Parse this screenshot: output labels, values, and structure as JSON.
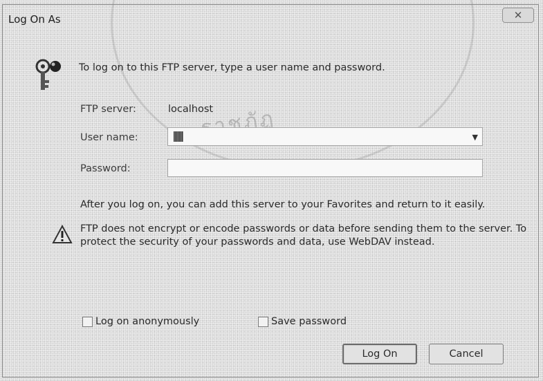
{
  "window": {
    "title": "Log On As"
  },
  "dialog": {
    "intro": "To log on to this FTP server, type a user name and password.",
    "ftp_server_label": "FTP server:",
    "ftp_server_value": "localhost",
    "user_name_label": "User name:",
    "user_name_value": "",
    "password_label": "Password:",
    "password_value": "",
    "after_text": "After you log on, you can add this server to your Favorites and return to it easily.",
    "warning_text": "FTP does not encrypt or encode passwords or data before sending them to the server.  To protect the security of your passwords and data, use WebDAV instead.",
    "anonymous_label": "Log on anonymously",
    "anonymous_checked": false,
    "save_password_label": "Save password",
    "save_password_checked": false,
    "logon_label": "Log On",
    "cancel_label": "Cancel"
  },
  "watermark": {
    "text": "ราชภัฏ"
  },
  "icons": {
    "close": "close-icon",
    "key": "key-icon",
    "warning": "warning-icon",
    "dropdown": "chevron-down-icon"
  }
}
